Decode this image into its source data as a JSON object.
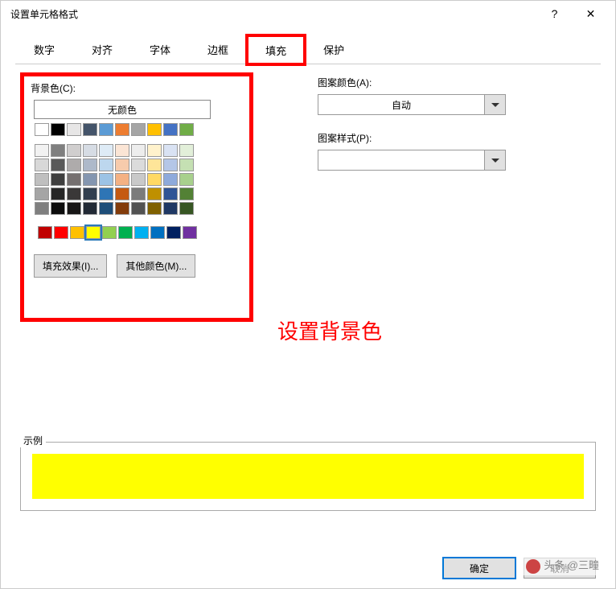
{
  "title": "设置单元格格式",
  "help": "?",
  "close": "✕",
  "tabs": {
    "t0": "数字",
    "t1": "对齐",
    "t2": "字体",
    "t3": "边框",
    "t4": "填充",
    "t5": "保护",
    "active": 4
  },
  "bg_label": "背景色(C):",
  "nocolor": "无颜色",
  "fill_effects": "填充效果(I)...",
  "more_colors": "其他颜色(M)...",
  "pattern_color_label": "图案颜色(A):",
  "pattern_color_value": "自动",
  "pattern_style_label": "图案样式(P):",
  "pattern_style_value": "",
  "annotation": "设置背景色",
  "sample_label": "示例",
  "ok": "确定",
  "cancel": "取消",
  "watermark": "头条 @三疃",
  "selected_color": "#ffff00",
  "theme_row1": [
    "#ffffff",
    "#000000",
    "#e7e6e6",
    "#44546a",
    "#5b9bd5",
    "#ed7d31",
    "#a5a5a5",
    "#ffc000",
    "#4472c4",
    "#70ad47"
  ],
  "theme_shades": [
    [
      "#f2f2f2",
      "#7f7f7f",
      "#d0cece",
      "#d6dce4",
      "#deebf6",
      "#fbe5d5",
      "#ededed",
      "#fff2cc",
      "#d9e2f3",
      "#e2efd9"
    ],
    [
      "#d8d8d8",
      "#595959",
      "#aeabab",
      "#adb9ca",
      "#bdd7ee",
      "#f7cbac",
      "#dbdbdb",
      "#fee599",
      "#b4c6e7",
      "#c5e0b3"
    ],
    [
      "#bfbfbf",
      "#3f3f3f",
      "#757070",
      "#8496b0",
      "#9cc3e5",
      "#f4b183",
      "#c9c9c9",
      "#ffd965",
      "#8eaadb",
      "#a8d08d"
    ],
    [
      "#a5a5a5",
      "#262626",
      "#3a3838",
      "#323f4f",
      "#2e75b5",
      "#c55a11",
      "#7b7b7b",
      "#bf9000",
      "#2f5496",
      "#538135"
    ],
    [
      "#7f7f7f",
      "#0c0c0c",
      "#171616",
      "#222a35",
      "#1e4e79",
      "#833c0b",
      "#525252",
      "#7f6000",
      "#1f3864",
      "#375623"
    ]
  ],
  "standard": [
    "#c00000",
    "#ff0000",
    "#ffc000",
    "#ffff00",
    "#92d050",
    "#00b050",
    "#00b0f0",
    "#0070c0",
    "#002060",
    "#7030a0"
  ]
}
